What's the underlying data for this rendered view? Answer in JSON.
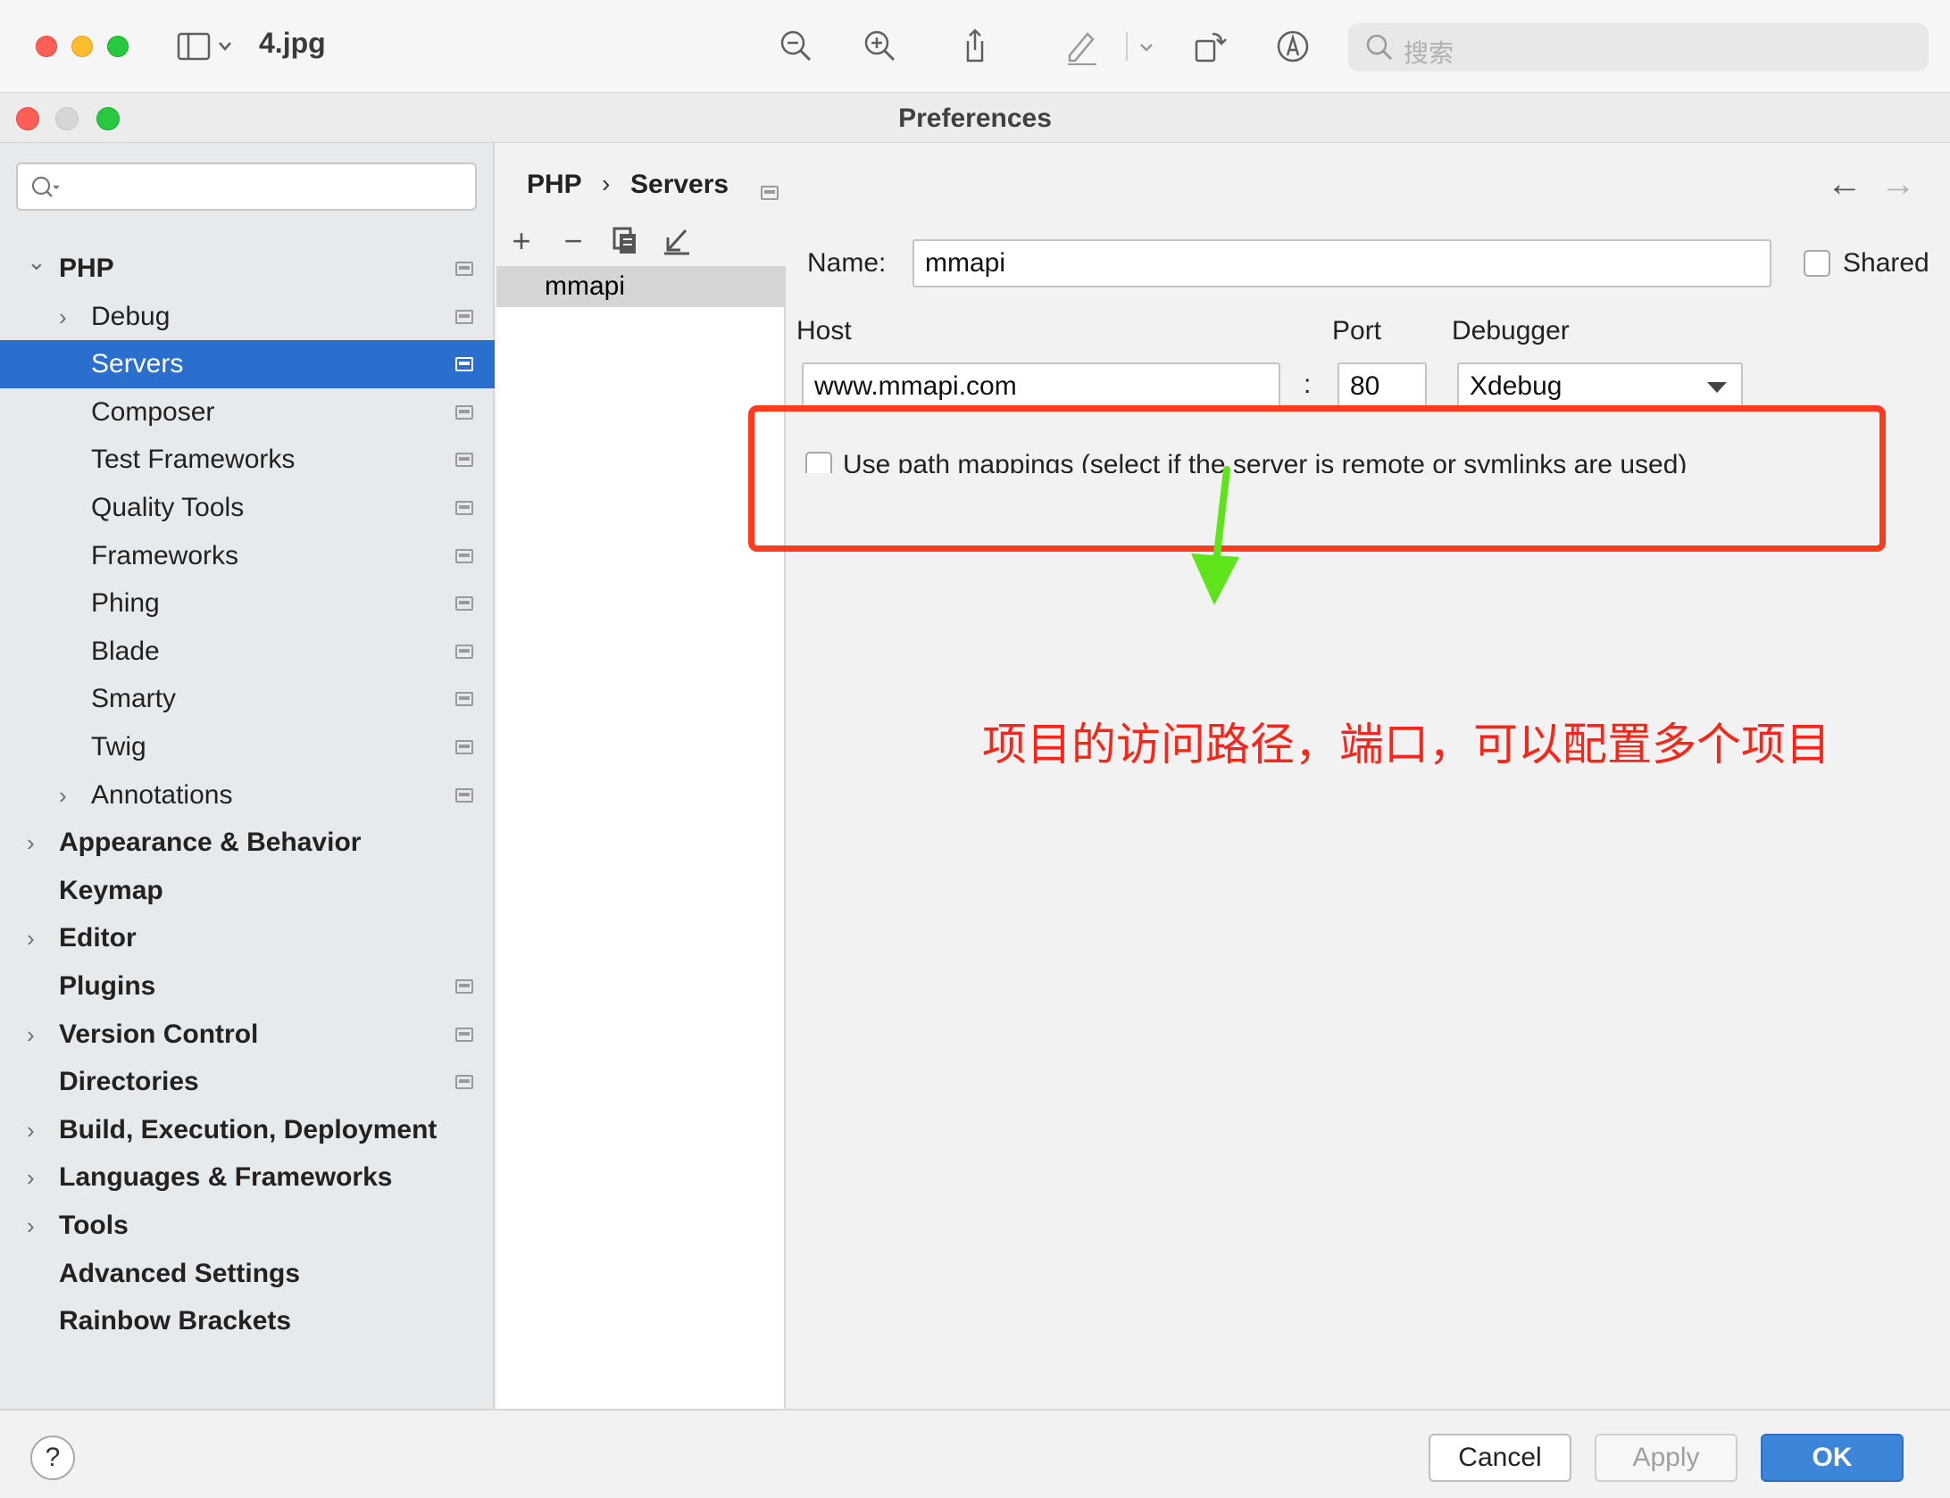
{
  "viewer": {
    "filename": "4.jpg",
    "search_placeholder": "搜索"
  },
  "window": {
    "title": "Preferences"
  },
  "nav": {
    "items": [
      {
        "label": "PHP",
        "bold": true,
        "chevron": "open"
      },
      {
        "label": "Debug",
        "bold": false,
        "chevron": "closed"
      },
      {
        "label": "Servers",
        "bold": false,
        "chevron": "",
        "selected": true
      },
      {
        "label": "Composer",
        "bold": false,
        "chevron": ""
      },
      {
        "label": "Test Frameworks",
        "bold": false,
        "chevron": ""
      },
      {
        "label": "Quality Tools",
        "bold": false,
        "chevron": ""
      },
      {
        "label": "Frameworks",
        "bold": false,
        "chevron": ""
      },
      {
        "label": "Phing",
        "bold": false,
        "chevron": ""
      },
      {
        "label": "Blade",
        "bold": false,
        "chevron": ""
      },
      {
        "label": "Smarty",
        "bold": false,
        "chevron": ""
      },
      {
        "label": "Twig",
        "bold": false,
        "chevron": ""
      },
      {
        "label": "Annotations",
        "bold": false,
        "chevron": "closed"
      },
      {
        "label": "Appearance & Behavior",
        "bold": true,
        "chevron": "closed"
      },
      {
        "label": "Keymap",
        "bold": true,
        "chevron": ""
      },
      {
        "label": "Editor",
        "bold": true,
        "chevron": "closed"
      },
      {
        "label": "Plugins",
        "bold": true,
        "chevron": ""
      },
      {
        "label": "Version Control",
        "bold": true,
        "chevron": "closed"
      },
      {
        "label": "Directories",
        "bold": true,
        "chevron": ""
      },
      {
        "label": "Build, Execution, Deployment",
        "bold": true,
        "chevron": "closed"
      },
      {
        "label": "Languages & Frameworks",
        "bold": true,
        "chevron": "closed"
      },
      {
        "label": "Tools",
        "bold": true,
        "chevron": "closed"
      },
      {
        "label": "Advanced Settings",
        "bold": true,
        "chevron": ""
      },
      {
        "label": "Rainbow Brackets",
        "bold": true,
        "chevron": ""
      }
    ]
  },
  "breadcrumb": {
    "parent": "PHP",
    "separator": "›",
    "current": "Servers"
  },
  "servers": {
    "toolbar": {
      "add": "+",
      "remove": "−"
    },
    "list": [
      "mmapi"
    ]
  },
  "form": {
    "name_label": "Name:",
    "name_value": "mmapi",
    "shared_label": "Shared",
    "host_label": "Host",
    "host_value": "www.mmapi.com",
    "colon": ":",
    "port_label": "Port",
    "port_value": "80",
    "debugger_label": "Debugger",
    "debugger_value": "Xdebug",
    "path_mappings_label": "Use path mappings (select if the server is remote or symlinks are used)"
  },
  "annotation": {
    "text": "项目的访问路径，端口，可以配置多个项目",
    "box_color": "#ff3b1f",
    "arrow_color": "#5fe31a"
  },
  "footer": {
    "help": "?",
    "cancel": "Cancel",
    "apply": "Apply",
    "ok": "OK"
  },
  "colors": {
    "selection": "#2a6fce",
    "primary_button": "#3d85d8"
  }
}
